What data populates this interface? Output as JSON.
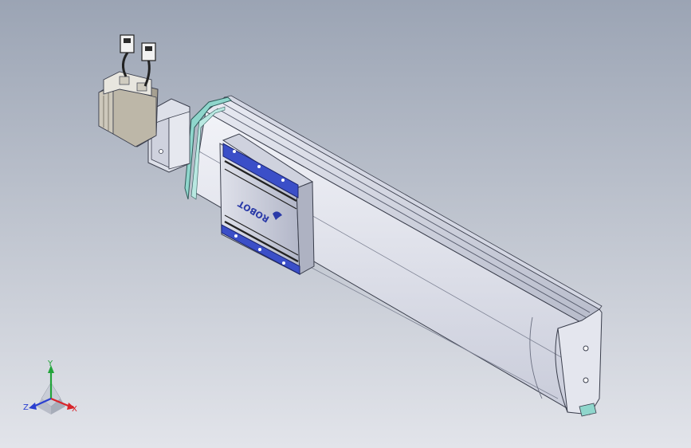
{
  "model": {
    "carriage_logo_text": "ROBOT"
  },
  "triad": {
    "x_label": "X",
    "y_label": "Y",
    "z_label": "Z",
    "x_color": "#d8242a",
    "y_color": "#22a43a",
    "z_color": "#2a3fd0"
  },
  "colors": {
    "background_top": "#9ba4b4",
    "background_bottom": "#e2e4ea",
    "carriage_accent": "#3b4fc8",
    "end_seal": "#8fd6cc"
  }
}
